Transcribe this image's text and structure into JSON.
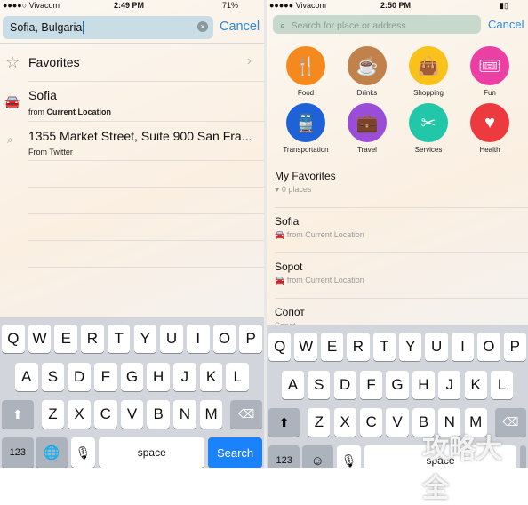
{
  "left": {
    "status": {
      "carrier": "●●●●○ Vivacom",
      "time": "2:49 PM",
      "battery": "71%"
    },
    "search": {
      "value": "Sofia, Bulgaria",
      "clear_icon": "clear-circle-icon"
    },
    "cancel": "Cancel",
    "favorites": {
      "label": "Favorites",
      "icon": "star-icon"
    },
    "results": [
      {
        "title": "Sofia",
        "prefix": "from ",
        "bold": "Current Location",
        "icon": "car-icon"
      },
      {
        "title": "1355 Market Street, Suite 900 San Fra...",
        "sub": "From Twitter",
        "icon": "search-icon"
      }
    ],
    "keyboard": {
      "rows": [
        [
          "Q",
          "W",
          "E",
          "R",
          "T",
          "Y",
          "U",
          "I",
          "O",
          "P"
        ],
        [
          "A",
          "S",
          "D",
          "F",
          "G",
          "H",
          "J",
          "K",
          "L"
        ],
        [
          "Z",
          "X",
          "C",
          "V",
          "B",
          "N",
          "M"
        ]
      ],
      "num": "123",
      "space": "space",
      "action": "Search"
    }
  },
  "right": {
    "status": {
      "carrier": "●●●●● Vivacom",
      "time": "2:50 PM"
    },
    "search": {
      "placeholder": "Search for place or address"
    },
    "cancel": "Cancel",
    "categories": [
      {
        "label": "Food",
        "color": "#f5891d",
        "icon": "fork-knife-icon",
        "glyph": "🍴"
      },
      {
        "label": "Drinks",
        "color": "#c0814a",
        "icon": "cup-icon",
        "glyph": "☕"
      },
      {
        "label": "Shopping",
        "color": "#f8c21a",
        "icon": "bag-icon",
        "glyph": "👜"
      },
      {
        "label": "Fun",
        "color": "#ec3fa4",
        "icon": "ticket-icon",
        "glyph": "🎟"
      },
      {
        "label": "Transportation",
        "color": "#1f62d8",
        "icon": "transport-icon",
        "glyph": "🚆"
      },
      {
        "label": "Travel",
        "color": "#9a4ed8",
        "icon": "suitcase-icon",
        "glyph": "💼"
      },
      {
        "label": "Services",
        "color": "#22c6a8",
        "icon": "scissors-icon",
        "glyph": "✂"
      },
      {
        "label": "Health",
        "color": "#ec3a3f",
        "icon": "heart-icon",
        "glyph": "♥"
      }
    ],
    "list": [
      {
        "title": "My Favorites",
        "sub": "♥ 0 places"
      },
      {
        "title": "Sofia",
        "sub": "🚘 from Current Location"
      },
      {
        "title": "Sopot",
        "sub": "🚘 from Current Location"
      },
      {
        "title": "Сопот",
        "sub": "Sopot"
      }
    ],
    "keyboard": {
      "rows": [
        [
          "Q",
          "W",
          "E",
          "R",
          "T",
          "Y",
          "U",
          "I",
          "O",
          "P"
        ],
        [
          "A",
          "S",
          "D",
          "F",
          "G",
          "H",
          "J",
          "K",
          "L"
        ],
        [
          "Z",
          "X",
          "C",
          "V",
          "B",
          "N",
          "M"
        ]
      ],
      "num": "123",
      "space": "space"
    }
  },
  "watermark": "攻略大全"
}
